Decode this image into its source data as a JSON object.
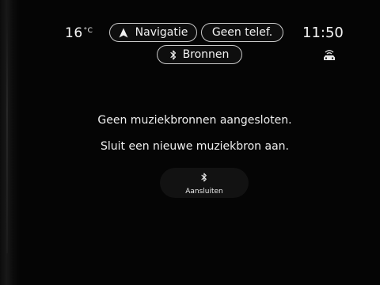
{
  "status": {
    "temperature_value": "16",
    "temperature_unit": "°C",
    "time": "11:50"
  },
  "top_buttons": {
    "navigation_label": "Navigatie",
    "phone_label": "Geen telef.",
    "sources_label": "Bronnen"
  },
  "message": {
    "line1": "Geen muziekbronnen aangesloten.",
    "line2": "Sluit een nieuwe muziekbron aan."
  },
  "connect": {
    "label": "Aansluiten"
  },
  "icons": {
    "navigation": "navigation-arrow-icon",
    "bluetooth": "bluetooth-icon",
    "connectivity": "wifi-car-icon"
  },
  "colors": {
    "background": "#050505",
    "text": "#f2f2f2",
    "pill_border": "#c8c8c8",
    "button_bg": "#121212"
  }
}
